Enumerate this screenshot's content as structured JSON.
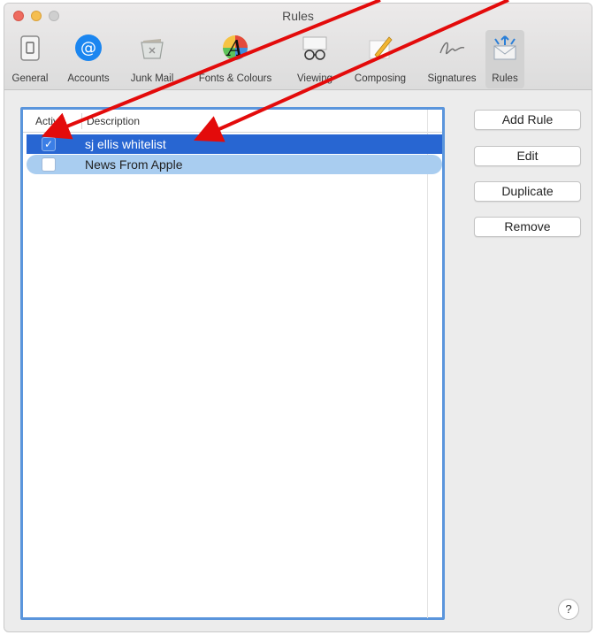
{
  "window": {
    "title": "Rules"
  },
  "toolbar": {
    "items": [
      {
        "label": "General",
        "icon": "general-switch-icon"
      },
      {
        "label": "Accounts",
        "icon": "at-sign-icon"
      },
      {
        "label": "Junk Mail",
        "icon": "junk-tray-icon"
      },
      {
        "label": "Fonts & Colours",
        "icon": "fonts-colours-icon"
      },
      {
        "label": "Viewing",
        "icon": "glasses-icon"
      },
      {
        "label": "Composing",
        "icon": "pencil-icon"
      },
      {
        "label": "Signatures",
        "icon": "signature-icon"
      },
      {
        "label": "Rules",
        "icon": "rules-envelope-icon"
      }
    ],
    "active": "Rules"
  },
  "table": {
    "headers": {
      "active": "Active",
      "description": "Description"
    },
    "rows": [
      {
        "active": true,
        "description": "sj ellis whitelist"
      },
      {
        "active": false,
        "description": "News From Apple"
      }
    ]
  },
  "buttons": {
    "add_rule": "Add Rule",
    "edit": "Edit",
    "duplicate": "Duplicate",
    "remove": "Remove",
    "help": "?"
  },
  "annotation": {
    "arrow_color": "#e30b0b"
  },
  "colors": {
    "selection": "#2866d2",
    "focus_ring": "#5a95dc",
    "secondary_selection": "#a9cdf0"
  }
}
